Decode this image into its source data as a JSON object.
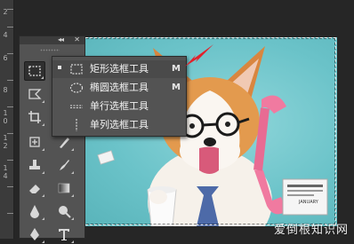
{
  "ruler": {
    "labels": [
      "2",
      "4",
      "6",
      "8",
      "1",
      "0",
      "1",
      "2",
      "1",
      "4"
    ]
  },
  "toolbox": {
    "collapse_glyph": "◂◂",
    "close_glyph": "✕"
  },
  "tools": [
    {
      "name": "rectangular-marquee-tool",
      "icon": "rect-marquee-icon",
      "active": true
    },
    {
      "name": "lasso-tool",
      "icon": "lasso-icon",
      "active": false
    },
    {
      "name": "crop-tool",
      "icon": "crop-icon",
      "active": false
    },
    {
      "name": "eyedropper-tool",
      "icon": "eyedropper-icon",
      "active": false
    },
    {
      "name": "spot-healing-tool",
      "icon": "healing-icon",
      "active": false
    },
    {
      "name": "brush-tool",
      "icon": "brush-icon",
      "active": false
    },
    {
      "name": "stamp-tool",
      "icon": "stamp-icon",
      "active": false
    },
    {
      "name": "history-brush-tool",
      "icon": "history-brush-icon",
      "active": false
    },
    {
      "name": "eraser-tool",
      "icon": "eraser-icon",
      "active": false
    },
    {
      "name": "gradient-tool",
      "icon": "gradient-icon",
      "active": false
    },
    {
      "name": "blur-tool",
      "icon": "blur-icon",
      "active": false
    },
    {
      "name": "dodge-tool",
      "icon": "dodge-icon",
      "active": false
    },
    {
      "name": "pen-tool",
      "icon": "pen-icon",
      "active": false
    },
    {
      "name": "type-tool",
      "icon": "type-icon",
      "active": false
    }
  ],
  "flyout": {
    "items": [
      {
        "label": "矩形选框工具",
        "shortcut": "M",
        "icon": "rect-marquee-icon",
        "selected": true
      },
      {
        "label": "椭圆选框工具",
        "shortcut": "M",
        "icon": "ellipse-marquee-icon",
        "selected": false
      },
      {
        "label": "单行选框工具",
        "shortcut": "",
        "icon": "single-row-marquee-icon",
        "selected": false
      },
      {
        "label": "单列选框工具",
        "shortcut": "",
        "icon": "single-column-marquee-icon",
        "selected": false
      }
    ]
  },
  "canvas": {
    "letter_text": "JANUARY",
    "watermark": "爱倒根知识网"
  },
  "colors": {
    "canvas_bg": "#6bc3c9",
    "annotation_arrow": "#e2212b",
    "panel": "#535353",
    "workspace": "#262626"
  }
}
